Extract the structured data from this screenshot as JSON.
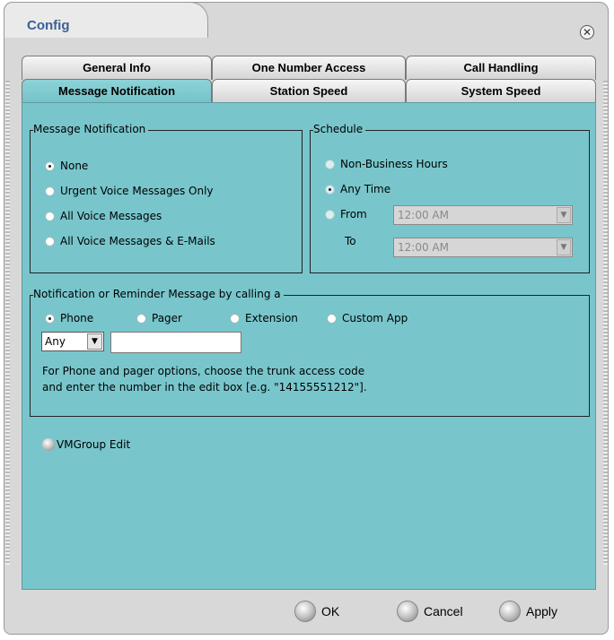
{
  "window": {
    "title": "Config"
  },
  "tabs": {
    "row1": [
      "General Info",
      "One Number Access",
      "Call Handling"
    ],
    "row2": [
      "Message Notification",
      "Station Speed",
      "System Speed"
    ],
    "active": "Message Notification"
  },
  "message_notification": {
    "legend": "Message Notification",
    "options": [
      "None",
      "Urgent Voice Messages Only",
      "All Voice Messages",
      "All Voice Messages & E-Mails"
    ],
    "selected": "None"
  },
  "schedule": {
    "legend": "Schedule",
    "options": [
      "Non-Business Hours",
      "Any Time",
      "From"
    ],
    "selected": "Any Time",
    "from_value": "12:00 AM",
    "to_label": "To",
    "to_value": "12:00 AM"
  },
  "reminder": {
    "legend": "Notification or Reminder Message  by calling a",
    "options": [
      "Phone",
      "Pager",
      "Extension",
      "Custom App"
    ],
    "selected": "Phone",
    "trunk_value": "Any",
    "number_value": "",
    "help_line1": "For Phone and pager options, choose the trunk access code",
    "help_line2": "and enter the number in the edit box [e.g. \"14155551212\"]."
  },
  "vmgroup": {
    "label": "VMGroup Edit"
  },
  "buttons": {
    "ok": "OK",
    "cancel": "Cancel",
    "apply": "Apply"
  },
  "colors": {
    "panel": "#78c6cc",
    "title": "#3b5f96",
    "frame": "#d8d8d8"
  }
}
